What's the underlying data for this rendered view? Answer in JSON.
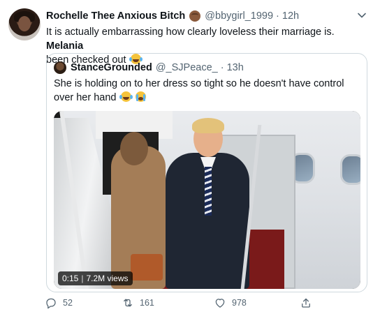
{
  "tweet": {
    "author": {
      "name": "Rochelle Thee Anxious Bitch",
      "handle": "@bbygirl_1999",
      "time": "12h",
      "separator": "·",
      "name_emoji": "fist-emoji"
    },
    "text": {
      "part1": "It is actually embarrassing how clearly loveless their marriage is.",
      "bold": "Melania",
      "part2": "been checked out",
      "emoji": "laughing-crying-emoji"
    },
    "more_icon": "chevron-down-icon",
    "quoted": {
      "name": "StanceGrounded",
      "handle": "@_SJPeace_",
      "time": "13h",
      "separator": "·",
      "text": "She is holding on to her dress so tight so he doesn't have control over her hand",
      "emojis": [
        "laughing-crying-emoji",
        "loudly-crying-emoji"
      ],
      "video": {
        "duration": "0:15",
        "views": "7.2M views",
        "separator": "|"
      }
    },
    "actions": {
      "reply_count": "52",
      "retweet_count": "161",
      "like_count": "978",
      "reply_icon": "reply-icon",
      "retweet_icon": "retweet-icon",
      "like_icon": "heart-icon",
      "share_icon": "share-icon"
    },
    "colors": {
      "text": "#0f1419",
      "secondary": "#536471",
      "border": "#cfd9de"
    }
  }
}
